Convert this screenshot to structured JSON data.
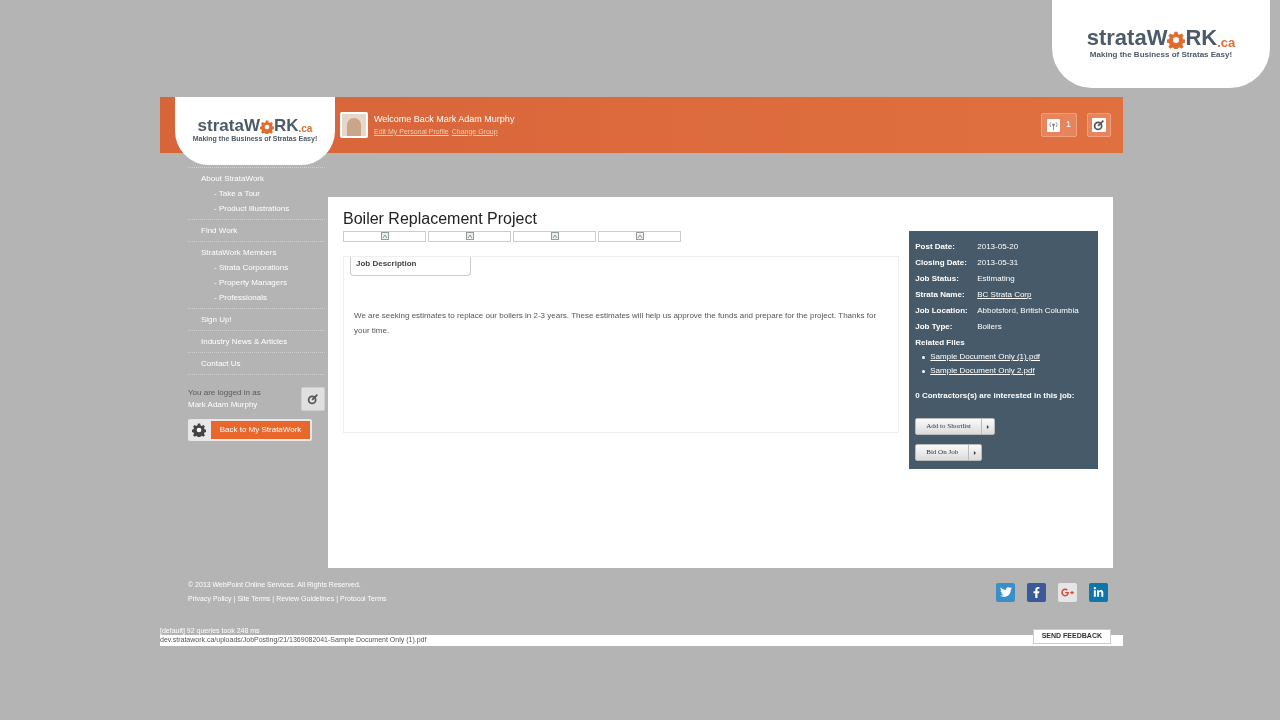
{
  "corner_logo": {
    "name_parts": [
      "strata",
      "W",
      "RK",
      ".ca"
    ],
    "tagline": "Making the Business of Stratas Easy!"
  },
  "header": {
    "logo": {
      "name_parts": [
        "strata",
        "W",
        "RK",
        ".ca"
      ],
      "tagline": "Making the Business of Stratas Easy!"
    },
    "welcome": "Welcome Back Mark Adam Murphy",
    "links": [
      "Edit My Personal Profile",
      "Change Group"
    ],
    "notification_count": "1"
  },
  "sidebar": {
    "items": [
      {
        "label": "About StrataWork",
        "children": [
          {
            "label": "- Take a Tour"
          },
          {
            "label": "- Product Illustrations"
          }
        ]
      },
      {
        "label": "Find Work"
      },
      {
        "label": "StrataWork Members",
        "children": [
          {
            "label": "- Strata Corporations"
          },
          {
            "label": "- Property Managers"
          },
          {
            "label": "- Professionals"
          }
        ]
      },
      {
        "label": "Sign Up!"
      },
      {
        "label": "Industry News & Articles"
      },
      {
        "label": "Contact Us"
      }
    ],
    "logged_in_text": "You are logged in as",
    "user_name": "Mark Adam Murphy",
    "back_button": "Back to My StrataWork"
  },
  "job": {
    "title": "Boiler Replacement Project",
    "image_tabs": [
      {
        "kind": "broken_image"
      },
      {
        "kind": "broken_image"
      },
      {
        "kind": "broken_image"
      },
      {
        "kind": "broken_image"
      }
    ],
    "section_tab": "Job Description",
    "description": "We are seeking estimates to replace our boilers in 2-3 years. These estimates will help us approve the funds and prepare for the project. Thanks for your time.",
    "details": [
      {
        "label": "Post Date:",
        "value": "2013-05-20",
        "kind": "text"
      },
      {
        "label": "Closing Date:",
        "value": "2013-05-31",
        "kind": "text"
      },
      {
        "label": "Job Status:",
        "value": "Estimating",
        "kind": "text"
      },
      {
        "label": "Strata Name:",
        "value": "BC Strata Corp",
        "kind": "link"
      },
      {
        "label": "Job Location:",
        "value": "Abbotsford, British Columbia",
        "kind": "text"
      },
      {
        "label": "Job Type:",
        "value": "Boilers",
        "kind": "text"
      }
    ],
    "related_files_label": "Related Files",
    "files": [
      "Sample Document Only (1).pdf",
      "Sample Document Only 2.pdf"
    ],
    "interest": "0 Contractors(s) are interested in this job:",
    "buttons": [
      "Add to Shortlist",
      "Bid On Job"
    ]
  },
  "footer": {
    "copyright": "© 2013 WebPoint Online Services. All Rights Reserved.",
    "links": [
      "Privacy Policy",
      "Site Terms",
      "Review Guidelines",
      "Protocol Terms"
    ],
    "separator": "|"
  },
  "status_bar": {
    "debug": "[default] 92 queries took 248 ms",
    "url": "dev.stratawork.ca/uploads/JobPosting/21/1369082041-Sample Document Only (1).pdf",
    "feedback": "SEND FEEDBACK"
  }
}
